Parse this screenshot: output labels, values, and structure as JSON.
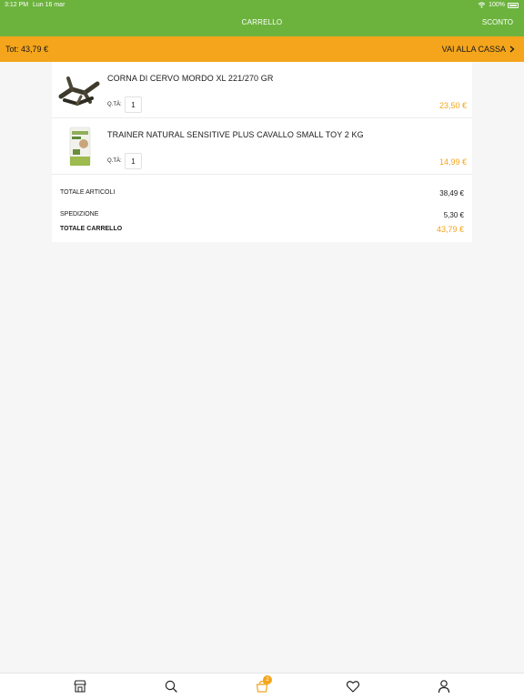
{
  "status_bar": {
    "time": "3:12 PM",
    "date": "Lun 16 mar",
    "battery": "100%"
  },
  "header": {
    "title": "CARRELLO",
    "right_action": "SCONTO"
  },
  "total_bar": {
    "total": "Tot: 43,79 €",
    "checkout": "VAI ALLA CASSA"
  },
  "cart": {
    "qty_label": "Q.TÀ:",
    "items": [
      {
        "title": "CORNA DI CERVO MORDO XL 221/270 GR",
        "qty": "1",
        "price": "23,50 €",
        "image_icon": "antler-chew-image"
      },
      {
        "title": "TRAINER NATURAL SENSITIVE PLUS CAVALLO SMALL TOY 2 KG",
        "qty": "1",
        "price": "14,99 €",
        "image_icon": "dog-food-bag-image"
      }
    ],
    "summary": {
      "items_label": "TOTALE ARTICOLI",
      "items_value": "38,49 €",
      "shipping_label": "SPEDIZIONE",
      "shipping_value": "5,30 €",
      "total_label": "TOTALE CARRELLO",
      "total_value": "43,79 €"
    }
  },
  "tabbar": {
    "items": [
      {
        "icon": "store-icon"
      },
      {
        "icon": "search-icon"
      },
      {
        "icon": "shopping-bag-icon",
        "badge": "2"
      },
      {
        "icon": "heart-icon"
      },
      {
        "icon": "user-icon"
      }
    ]
  },
  "colors": {
    "header_green": "#6cb33e",
    "accent_orange": "#f4a51c"
  }
}
